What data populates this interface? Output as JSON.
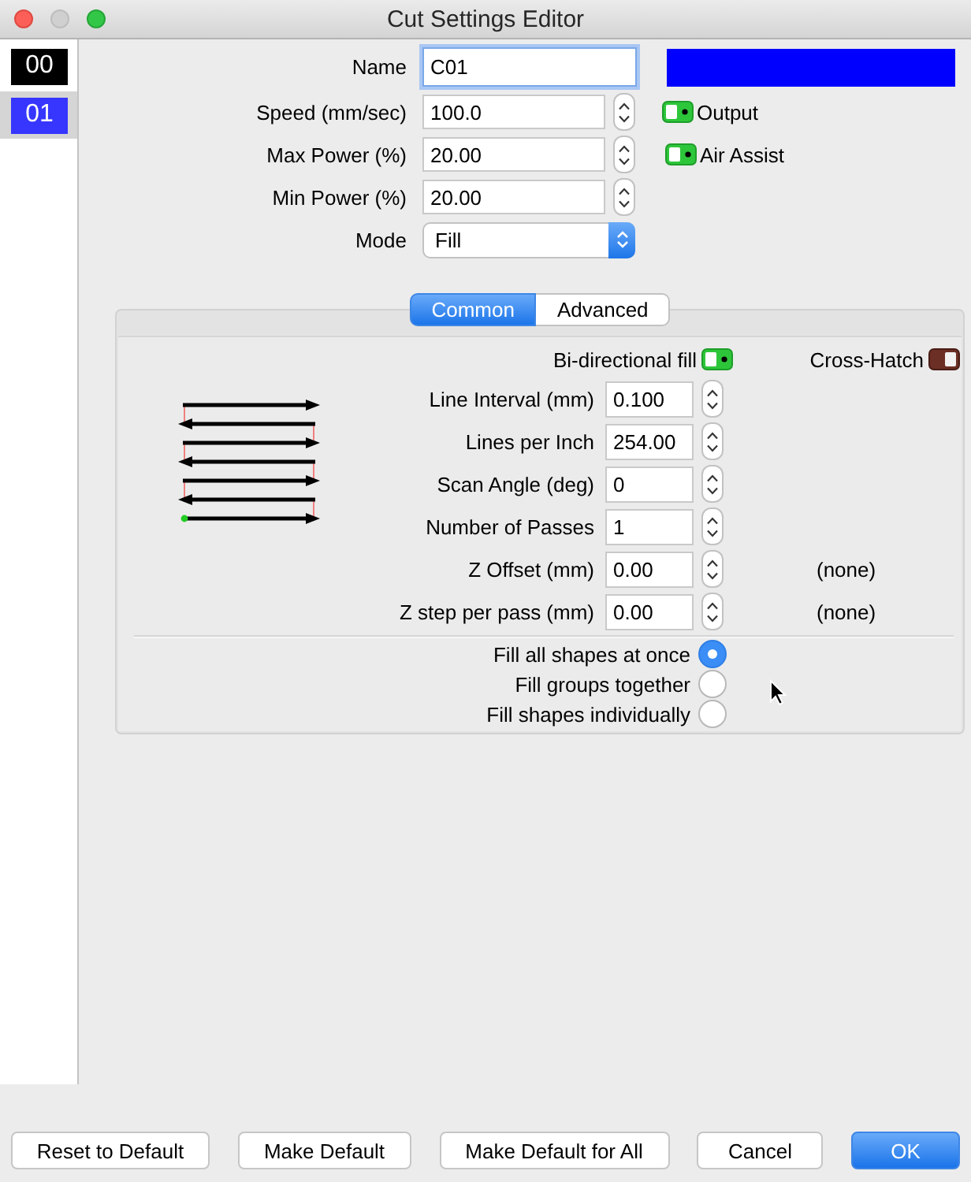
{
  "window": {
    "title": "Cut Settings Editor"
  },
  "layers": [
    {
      "label": "00",
      "color": "#000000",
      "selected": false
    },
    {
      "label": "01",
      "color": "#3636ff",
      "selected": true
    }
  ],
  "form": {
    "name": {
      "label": "Name",
      "value": "C01",
      "focused": true
    },
    "color": "#0000ff",
    "fields": [
      {
        "label": "Speed (mm/sec)",
        "value": "100.0"
      },
      {
        "label": "Max Power (%)",
        "value": "20.00"
      },
      {
        "label": "Min Power (%)",
        "value": "20.00"
      }
    ],
    "mode": {
      "label": "Mode",
      "value": "Fill"
    },
    "toggles": [
      {
        "label": "Output",
        "on": true
      },
      {
        "label": "Air Assist",
        "on": true
      }
    ]
  },
  "tabs": [
    {
      "label": "Common",
      "selected": true
    },
    {
      "label": "Advanced",
      "selected": false
    }
  ],
  "common": {
    "switches": [
      {
        "label": "Bi-directional fill",
        "on": true
      },
      {
        "label": "Cross-Hatch",
        "on": false
      }
    ],
    "fields": [
      {
        "label": "Line Interval (mm)",
        "value": "0.100"
      },
      {
        "label": "Lines per Inch",
        "value": "254.00"
      },
      {
        "label": "Scan Angle (deg)",
        "value": "0"
      },
      {
        "label": "Number of Passes",
        "value": "1"
      },
      {
        "label": "Z Offset (mm)",
        "value": "0.00",
        "note": "(none)"
      },
      {
        "label": "Z step per pass (mm)",
        "value": "0.00",
        "note": "(none)"
      }
    ],
    "fill_order": [
      {
        "label": "Fill all shapes at once",
        "selected": true
      },
      {
        "label": "Fill groups together",
        "selected": false
      },
      {
        "label": "Fill shapes individually",
        "selected": false
      }
    ]
  },
  "buttons": [
    {
      "label": "Reset to Default",
      "kind": "normal"
    },
    {
      "label": "Make Default",
      "kind": "normal"
    },
    {
      "label": "Make Default for All",
      "kind": "normal"
    },
    {
      "label": "Cancel",
      "kind": "normal"
    },
    {
      "label": "OK",
      "kind": "default"
    }
  ]
}
